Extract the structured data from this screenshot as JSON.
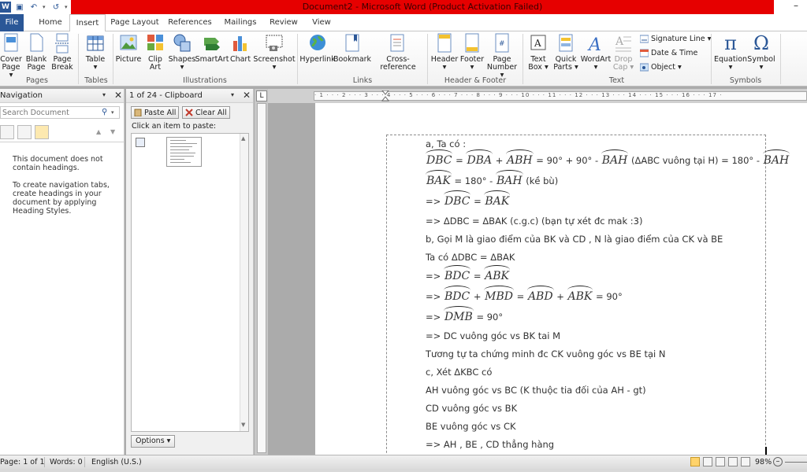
{
  "window": {
    "title": "Document2 - Microsoft Word (Product Activation Failed)",
    "minimize_label": "–",
    "title_color": "#e60000"
  },
  "qat": {
    "icons": [
      "word-logo-icon",
      "save-icon",
      "undo-icon",
      "redo-icon",
      "customize-icon"
    ],
    "word_glyph": "W",
    "save_glyph": "▣",
    "undo_glyph": "↶",
    "redo_glyph": "↺",
    "drop_glyph": "▾"
  },
  "tabs": [
    {
      "label": "File"
    },
    {
      "label": "Home"
    },
    {
      "label": "Insert"
    },
    {
      "label": "Page Layout"
    },
    {
      "label": "References"
    },
    {
      "label": "Mailings"
    },
    {
      "label": "Review"
    },
    {
      "label": "View"
    }
  ],
  "ribbon": {
    "groups": {
      "pages": "Pages",
      "tables": "Tables",
      "illustrations": "Illustrations",
      "links": "Links",
      "header_footer": "Header & Footer",
      "text": "Text",
      "symbols": "Symbols"
    },
    "buttons": {
      "cover": "Cover\nPage ▾",
      "blank": "Blank\nPage",
      "break": "Page\nBreak",
      "table": "Table\n▾",
      "picture": "Picture",
      "clipart": "Clip\nArt",
      "shapes": "Shapes\n▾",
      "smartart": "SmartArt",
      "chart": "Chart",
      "screenshot": "Screenshot\n▾",
      "hyperlink": "Hyperlink",
      "bookmark": "Bookmark",
      "crossref": "Cross-reference",
      "header": "Header\n▾",
      "footer": "Footer\n▾",
      "pagenum": "Page\nNumber ▾",
      "textbox": "Text\nBox ▾",
      "quickparts": "Quick\nParts ▾",
      "wordart": "WordArt\n▾",
      "dropcap": "Drop\nCap ▾",
      "equation": "Equation\n▾",
      "symbol": "Symbol\n▾"
    },
    "small": {
      "signature": "Signature Line ▾",
      "datetime": "Date & Time",
      "object": "Object ▾"
    },
    "glyphs": {
      "pi": "π",
      "omega": "Ω",
      "wordart": "A",
      "textbox": "A"
    }
  },
  "nav_pane": {
    "title": "Navigation",
    "arrow": "▾",
    "close": "✕",
    "search_placeholder": "Search Document",
    "search_icon": "⚲",
    "prev": "▲",
    "next": "▼",
    "msg1": "This document does not contain headings.",
    "msg2": "To create navigation tabs, create headings in your document by applying Heading Styles."
  },
  "clipboard": {
    "title": "1 of 24 - Clipboard",
    "arrow": "▾",
    "close": "✕",
    "paste_all": "Paste All",
    "clear_all": "Clear All",
    "hint": "Click an item to paste:",
    "options": "Options ▾",
    "scroll_up": "▲",
    "scroll_down": "▼"
  },
  "ruler": {
    "tab_glyph": "L",
    "marks": "· 1 · · · 2 · · · 3 · · · 4 · · · 5 · · · 6 · · · 7 · · · 8 · · · 9 · · · 10 · · · 11 · · · 12 · · · 13 · · · 14 · · · 15 · · · 16 · · · 17 ·"
  },
  "document": {
    "l1": "a, Ta có :",
    "l2": {
      "dbc": "DBC",
      "eq": " = ",
      "dba": "DBA",
      "plus": " + ",
      "abh": "ABH",
      "mid": " = 90° + 90° - ",
      "bah": "BAH",
      "note": " (ΔABC vuông tại H) = 180° - ",
      "bah2": "BAH"
    },
    "l3": {
      "bak": "BAK",
      "mid": " = 180° - ",
      "bah": "BAH",
      "tail": " (kề bù)"
    },
    "l4": {
      "pre": "=> ",
      "dbc": "DBC",
      "eq": " = ",
      "bak": "BAK"
    },
    "l5": "=> ΔDBC = ΔBAK (c.g.c) (bạn tự xét đc mak :3)",
    "l6": "b, Gọi M là giao điểm của BK và CD , N là giao điểm của CK và BE",
    "l7": "Ta có ΔDBC = ΔBAK",
    "l8": {
      "pre": "=> ",
      "bdc": "BDC",
      "eq": " = ",
      "abk": "ABK"
    },
    "l9": {
      "pre": " => ",
      "bdc": "BDC",
      "plus": " + ",
      "mbd": "MBD",
      "eq": " = ",
      "abd": "ABD",
      "plus2": " + ",
      "abk": "ABK",
      "tail": " = 90°"
    },
    "l10": {
      "pre": "=> ",
      "dmb": "DMB",
      "tail": " = 90°"
    },
    "l11": "=> DC vuông góc vs BK tai M",
    "l12": "Tương tự ta chứng minh đc CK vuông góc vs BE tại N",
    "l13": "c, Xét ΔKBC có",
    "l14": "AH vuông góc vs BC (K thuộc tia đối của AH - gt)",
    "l15": "CD vuông góc vs BK",
    "l16": "BE vuông góc vs CK",
    "l17": "=> AH , BE , CD thẳng hàng"
  },
  "status": {
    "page": "Page: 1 of 1",
    "words": "Words: 0",
    "lang": "English (U.S.)",
    "zoom": "98%",
    "zoom_out": "–"
  }
}
